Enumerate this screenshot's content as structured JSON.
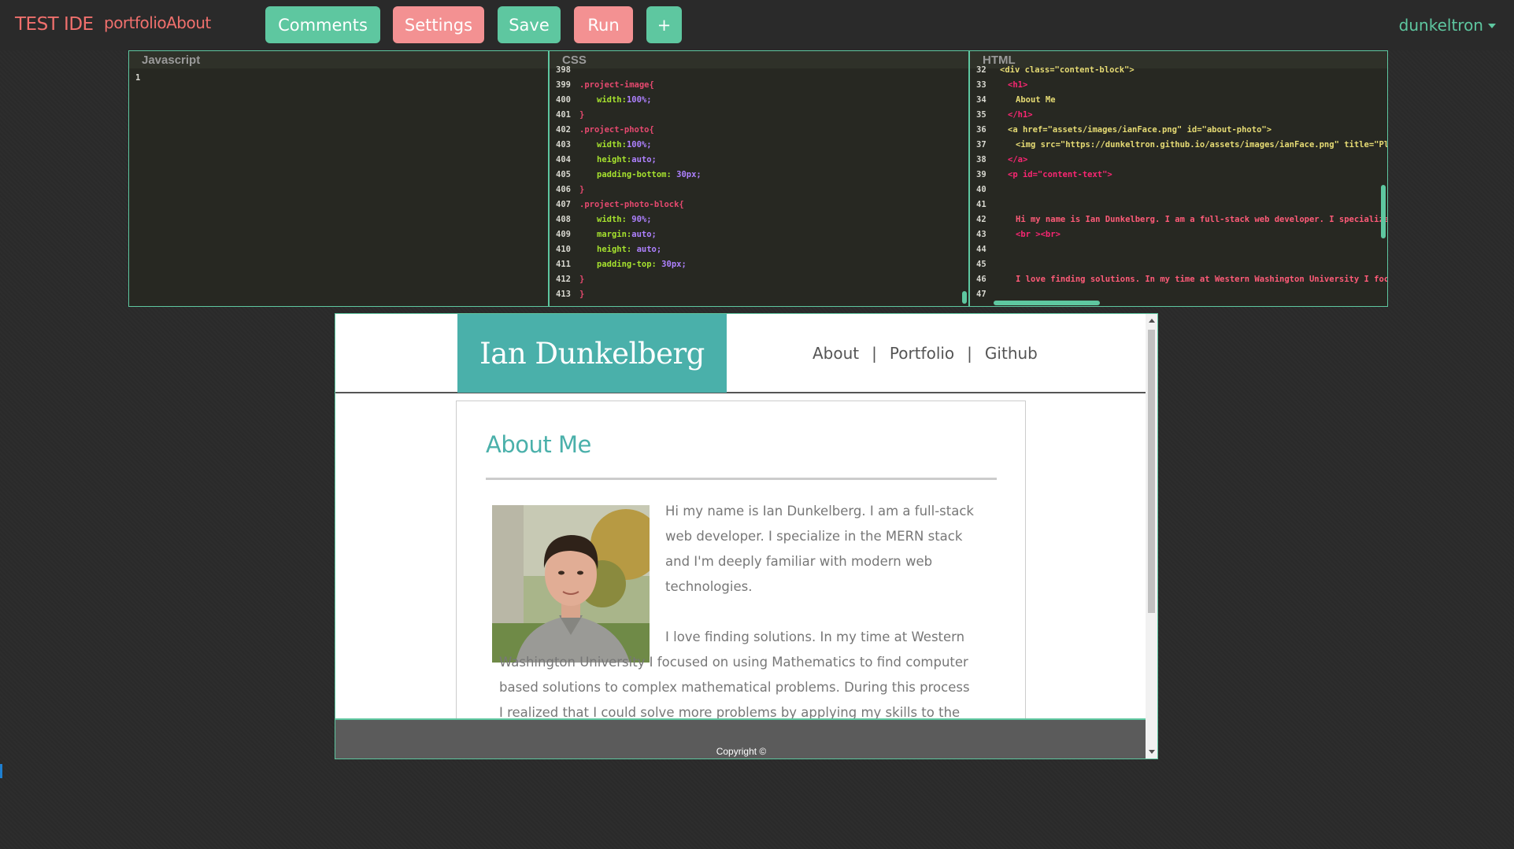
{
  "navbar": {
    "brand": "TEST IDE",
    "project_name": "portfolioAbout",
    "buttons": {
      "comments": "Comments",
      "settings": "Settings",
      "save": "Save",
      "run": "Run",
      "add": "+"
    },
    "user": "dunkeltron",
    "colors": {
      "green": "#5ec7a0",
      "pink": "#f39192",
      "brand": "#f0706d"
    }
  },
  "editors": {
    "javascript": {
      "title": "Javascript",
      "lines": [
        {
          "n": "1",
          "t": ""
        }
      ]
    },
    "css": {
      "title": "CSS",
      "lines": [
        {
          "n": "398",
          "t": "",
          "cls": "c-plain"
        },
        {
          "n": "399",
          "t": ".project-image{",
          "cls": "c-sel"
        },
        {
          "n": "400",
          "t": "width:100%;",
          "cls": "prop",
          "indent": true
        },
        {
          "n": "401",
          "t": "}",
          "cls": "c-sel"
        },
        {
          "n": "402",
          "t": ".project-photo{",
          "cls": "c-sel"
        },
        {
          "n": "403",
          "t": "width:100%;",
          "cls": "prop",
          "indent": true
        },
        {
          "n": "404",
          "t": "height:auto;",
          "cls": "prop",
          "indent": true
        },
        {
          "n": "405",
          "t": "padding-bottom: 30px;",
          "cls": "prop",
          "indent": true
        },
        {
          "n": "406",
          "t": "}",
          "cls": "c-sel"
        },
        {
          "n": "407",
          "t": ".project-photo-block{",
          "cls": "c-sel"
        },
        {
          "n": "408",
          "t": "width: 90%;",
          "cls": "prop",
          "indent": true
        },
        {
          "n": "409",
          "t": "margin:auto;",
          "cls": "prop",
          "indent": true
        },
        {
          "n": "410",
          "t": "height: auto;",
          "cls": "prop",
          "indent": true
        },
        {
          "n": "411",
          "t": "padding-top: 30px;",
          "cls": "prop",
          "indent": true
        },
        {
          "n": "412",
          "t": "}",
          "cls": "c-sel"
        },
        {
          "n": "413",
          "t": "}",
          "cls": "c-sel"
        }
      ]
    },
    "html": {
      "title": "HTML",
      "lines": [
        {
          "n": "32",
          "t": "<div class=\"content-block\">",
          "cls": "c-str",
          "pad": 0
        },
        {
          "n": "33",
          "t": "<h1>",
          "cls": "c-tag",
          "pad": 1
        },
        {
          "n": "34",
          "t": "About Me",
          "cls": "c-str",
          "pad": 2
        },
        {
          "n": "35",
          "t": "</h1>",
          "cls": "c-tag",
          "pad": 1
        },
        {
          "n": "36",
          "t": "<a href=\"assets/images/ianFace.png\" id=\"about-photo\">",
          "cls": "c-str",
          "pad": 1
        },
        {
          "n": "37",
          "t": "<img src=\"https://dunkeltron.github.io/assets/images/ianFace.png\" title=\"Placehold",
          "cls": "c-str",
          "pad": 2
        },
        {
          "n": "38",
          "t": "</a>",
          "cls": "c-tag",
          "pad": 1
        },
        {
          "n": "39",
          "t": "<p id=\"content-text\">",
          "cls": "c-tag",
          "pad": 1
        },
        {
          "n": "40",
          "t": "",
          "cls": "c-plain",
          "pad": 0
        },
        {
          "n": "41",
          "t": "",
          "cls": "c-plain",
          "pad": 0
        },
        {
          "n": "42",
          "t": "Hi my name is Ian Dunkelberg. I am a full-stack web developer. I specialize in the MER",
          "cls": "c-txt",
          "pad": 2
        },
        {
          "n": "43",
          "t": "<br ><br>",
          "cls": "c-tag",
          "pad": 2
        },
        {
          "n": "44",
          "t": "",
          "cls": "c-plain",
          "pad": 0
        },
        {
          "n": "45",
          "t": "",
          "cls": "c-plain",
          "pad": 0
        },
        {
          "n": "46",
          "t": "I love finding solutions. In my time at Western Washington University I focused on us",
          "cls": "c-txt",
          "pad": 2
        },
        {
          "n": "47",
          "t": "",
          "cls": "c-plain",
          "pad": 0
        }
      ]
    }
  },
  "preview": {
    "site_title": "Ian Dunkelberg",
    "nav": {
      "about": "About",
      "sep": "|",
      "portfolio": "Portfolio",
      "github": "Github"
    },
    "heading": "About Me",
    "para1": "Hi my name is Ian Dunkelberg. I am a full-stack web developer. I specialize in the MERN stack and I'm deeply familiar with modern web technologies.",
    "para2": "I love finding solutions. In my time at Western Washington University I focused on using Mathematics to find computer based solutions to complex mathematical problems. During this process I realized that I could solve more problems by applying my skills to the web. I graduated from the University",
    "copyright": "Copyright ©",
    "colors": {
      "accent": "#4ab0aa",
      "footer": "#5b5b5b"
    }
  }
}
